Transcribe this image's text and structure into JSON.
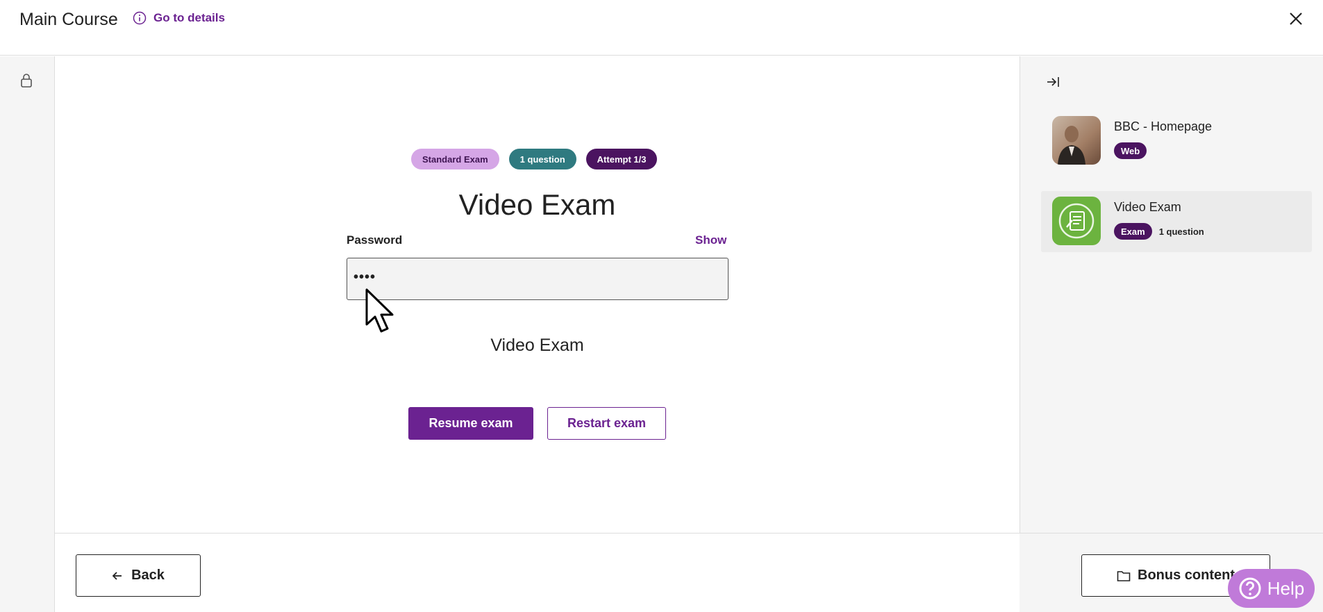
{
  "header": {
    "course_title": "Main Course",
    "details_link": "Go to details"
  },
  "exam": {
    "badges": {
      "type": "Standard Exam",
      "questions": "1 question",
      "attempt": "Attempt 1/3"
    },
    "title": "Video Exam",
    "password_label": "Password",
    "show_label": "Show",
    "password_masked": "••••",
    "subtitle": "Video Exam",
    "resume_label": "Resume exam",
    "restart_label": "Restart exam"
  },
  "footer": {
    "back_label": "Back",
    "bonus_label": "Bonus content"
  },
  "sidebar": {
    "items": [
      {
        "title": "BBC - Homepage",
        "tag": "Web",
        "meta": "",
        "active": false
      },
      {
        "title": "Video Exam",
        "tag": "Exam",
        "meta": "1 question",
        "active": true
      }
    ]
  },
  "help": {
    "label": "Help"
  },
  "colors": {
    "brand_purple": "#6b2291",
    "dark_plum": "#4b1460",
    "teal": "#2f7a80",
    "lavender": "#d5a6e6",
    "help_bg": "#c07ad9",
    "exam_icon_green": "#6cb33f"
  },
  "icons": [
    "info-icon",
    "close-icon",
    "lock-icon",
    "collapse-panel-icon",
    "arrow-left-icon",
    "folder-icon",
    "question-circle-icon",
    "exam-document-icon",
    "pointer-cursor"
  ]
}
